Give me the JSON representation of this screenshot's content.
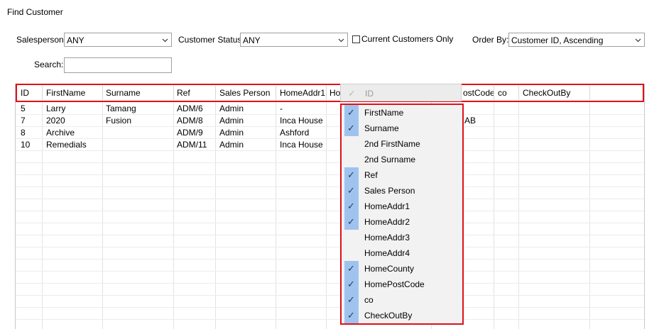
{
  "window": {
    "title": "Find Customer"
  },
  "filters": {
    "salesperson_label": "Salesperson:",
    "salesperson_value": "ANY",
    "status_label": "Customer Status:",
    "status_value": "ANY",
    "current_only_label": "Current Customers Only",
    "current_only_checked": false,
    "order_label": "Order By:",
    "order_value": "Customer ID, Ascending",
    "search_label": "Search:",
    "search_value": ""
  },
  "grid": {
    "headers": [
      "ID",
      "FirstName",
      "Surname",
      "Ref",
      "Sales Person",
      "HomeAddr1",
      "Ho",
      "ostCode",
      "co",
      "CheckOutBy"
    ],
    "rows": [
      {
        "id": "5",
        "first": "Larry",
        "surname": "Tamang",
        "ref": "ADM/6",
        "sales": "Admin",
        "addr1": "-",
        "post": ""
      },
      {
        "id": "7",
        "first": "2020",
        "surname": "Fusion",
        "ref": "ADM/8",
        "sales": "Admin",
        "addr1": "Inca House",
        "post": "AB"
      },
      {
        "id": "8",
        "first": "Archive",
        "surname": "",
        "ref": "ADM/9",
        "sales": "Admin",
        "addr1": "Ashford",
        "post": ""
      },
      {
        "id": "10",
        "first": "Remedials",
        "surname": "",
        "ref": "ADM/11",
        "sales": "Admin",
        "addr1": "Inca House",
        "post": ""
      }
    ]
  },
  "column_menu": {
    "disabled_item": "ID",
    "items": [
      {
        "label": "FirstName",
        "checked": true
      },
      {
        "label": "Surname",
        "checked": true
      },
      {
        "label": "2nd FirstName",
        "checked": false
      },
      {
        "label": "2nd Surname",
        "checked": false
      },
      {
        "label": "Ref",
        "checked": true
      },
      {
        "label": "Sales Person",
        "checked": true
      },
      {
        "label": "HomeAddr1",
        "checked": true
      },
      {
        "label": "HomeAddr2",
        "checked": true
      },
      {
        "label": "HomeAddr3",
        "checked": false
      },
      {
        "label": "HomeAddr4",
        "checked": false
      },
      {
        "label": "HomeCounty",
        "checked": true
      },
      {
        "label": "HomePostCode",
        "checked": true
      },
      {
        "label": "co",
        "checked": true
      },
      {
        "label": "CheckOutBy",
        "checked": true
      }
    ]
  },
  "colors": {
    "highlight": "#e0101a",
    "check_band": "#9fc3ee",
    "menu_bg": "#f2f2f2"
  }
}
